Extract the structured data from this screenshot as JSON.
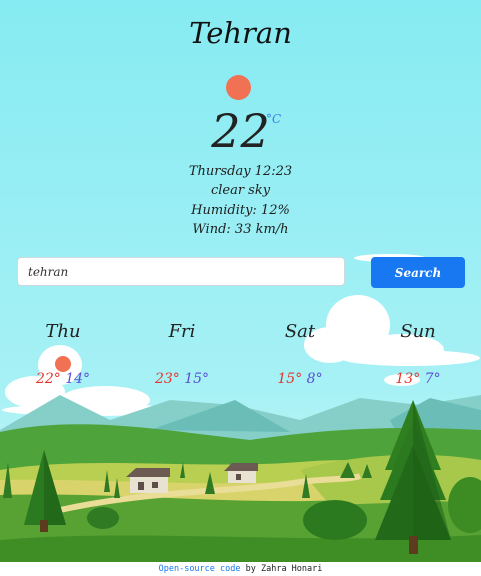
{
  "weather": {
    "city": "Tehran",
    "temperature": "22",
    "unit": "°C",
    "datetime": "Thursday 12:23",
    "description": "clear sky",
    "humidity": "Humidity: 12%",
    "wind": "Wind: 33 km/h",
    "icon": "sun-icon"
  },
  "search": {
    "value": "tehran",
    "button_label": "Search"
  },
  "forecast": [
    {
      "day": "Thu",
      "high": "22°",
      "low": "14°",
      "icon": "sun-icon"
    },
    {
      "day": "Fri",
      "high": "23°",
      "low": "15°"
    },
    {
      "day": "Sat",
      "high": "15°",
      "low": "8°"
    },
    {
      "day": "Sun",
      "high": "13°",
      "low": "7°"
    }
  ],
  "footer": {
    "link_text": "Open-source code",
    "author_text": "by Zahra Honari"
  },
  "colors": {
    "sky": "#84eaf1",
    "accent": "#1778f2",
    "sun": "#f07154",
    "high_temp": "#e5352b",
    "low_temp": "#5a4ed6"
  }
}
